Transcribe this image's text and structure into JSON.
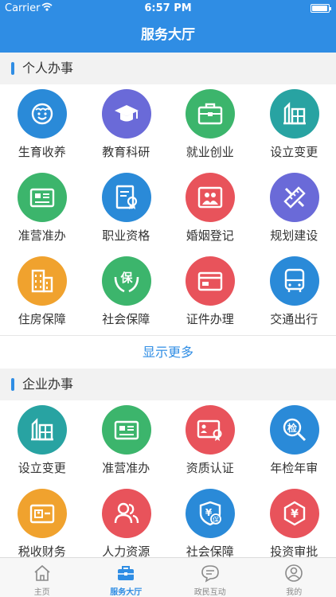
{
  "status_bar": {
    "carrier": "Carrier",
    "time": "6:57 PM"
  },
  "nav": {
    "title": "服务大厅"
  },
  "personal": {
    "title": "个人办事",
    "items": [
      {
        "label": "生育收养",
        "icon": "baby-face-icon",
        "color": "#2a8ad8"
      },
      {
        "label": "教育科研",
        "icon": "graduation-cap-icon",
        "color": "#6a6ad8"
      },
      {
        "label": "就业创业",
        "icon": "briefcase-icon",
        "color": "#3cb56c"
      },
      {
        "label": "设立变更",
        "icon": "building-setup-icon",
        "color": "#28a3a2"
      },
      {
        "label": "准营准办",
        "icon": "license-card-icon",
        "color": "#3cb56c"
      },
      {
        "label": "职业资格",
        "icon": "certificate-icon",
        "color": "#2a8ad8"
      },
      {
        "label": "婚姻登记",
        "icon": "couple-photo-icon",
        "color": "#e8535b"
      },
      {
        "label": "规划建设",
        "icon": "ruler-pencil-icon",
        "color": "#6a6ad8"
      },
      {
        "label": "住房保障",
        "icon": "building-icon",
        "color": "#f0a22e"
      },
      {
        "label": "社会保障",
        "icon": "hands-protect-icon",
        "color": "#3cb56c"
      },
      {
        "label": "证件办理",
        "icon": "id-card-icon",
        "color": "#e8535b"
      },
      {
        "label": "交通出行",
        "icon": "bus-icon",
        "color": "#2a8ad8"
      }
    ],
    "more_label": "显示更多"
  },
  "enterprise": {
    "title": "企业办事",
    "items": [
      {
        "label": "设立变更",
        "icon": "building-setup-icon",
        "color": "#28a3a2"
      },
      {
        "label": "准营准办",
        "icon": "license-card-icon",
        "color": "#3cb56c"
      },
      {
        "label": "资质认证",
        "icon": "qualification-card-icon",
        "color": "#e8535b"
      },
      {
        "label": "年检年审",
        "icon": "inspection-search-icon",
        "color": "#2a8ad8"
      },
      {
        "label": "税收财务",
        "icon": "tax-card-icon",
        "color": "#f0a22e"
      },
      {
        "label": "人力资源",
        "icon": "people-icon",
        "color": "#e8535b"
      },
      {
        "label": "社会保障",
        "icon": "yuan-shield-icon",
        "color": "#2a8ad8"
      },
      {
        "label": "投资审批",
        "icon": "yuan-hexagon-icon",
        "color": "#e8535b"
      }
    ]
  },
  "tabs": [
    {
      "label": "主页",
      "icon": "home-icon",
      "active": false
    },
    {
      "label": "服务大厅",
      "icon": "briefcase-tab-icon",
      "active": true
    },
    {
      "label": "政民互动",
      "icon": "chat-bubble-icon",
      "active": false
    },
    {
      "label": "我的",
      "icon": "user-profile-icon",
      "active": false
    }
  ],
  "colors": {
    "primary": "#2f8de4",
    "inactive_tab": "#8a8a8a"
  }
}
